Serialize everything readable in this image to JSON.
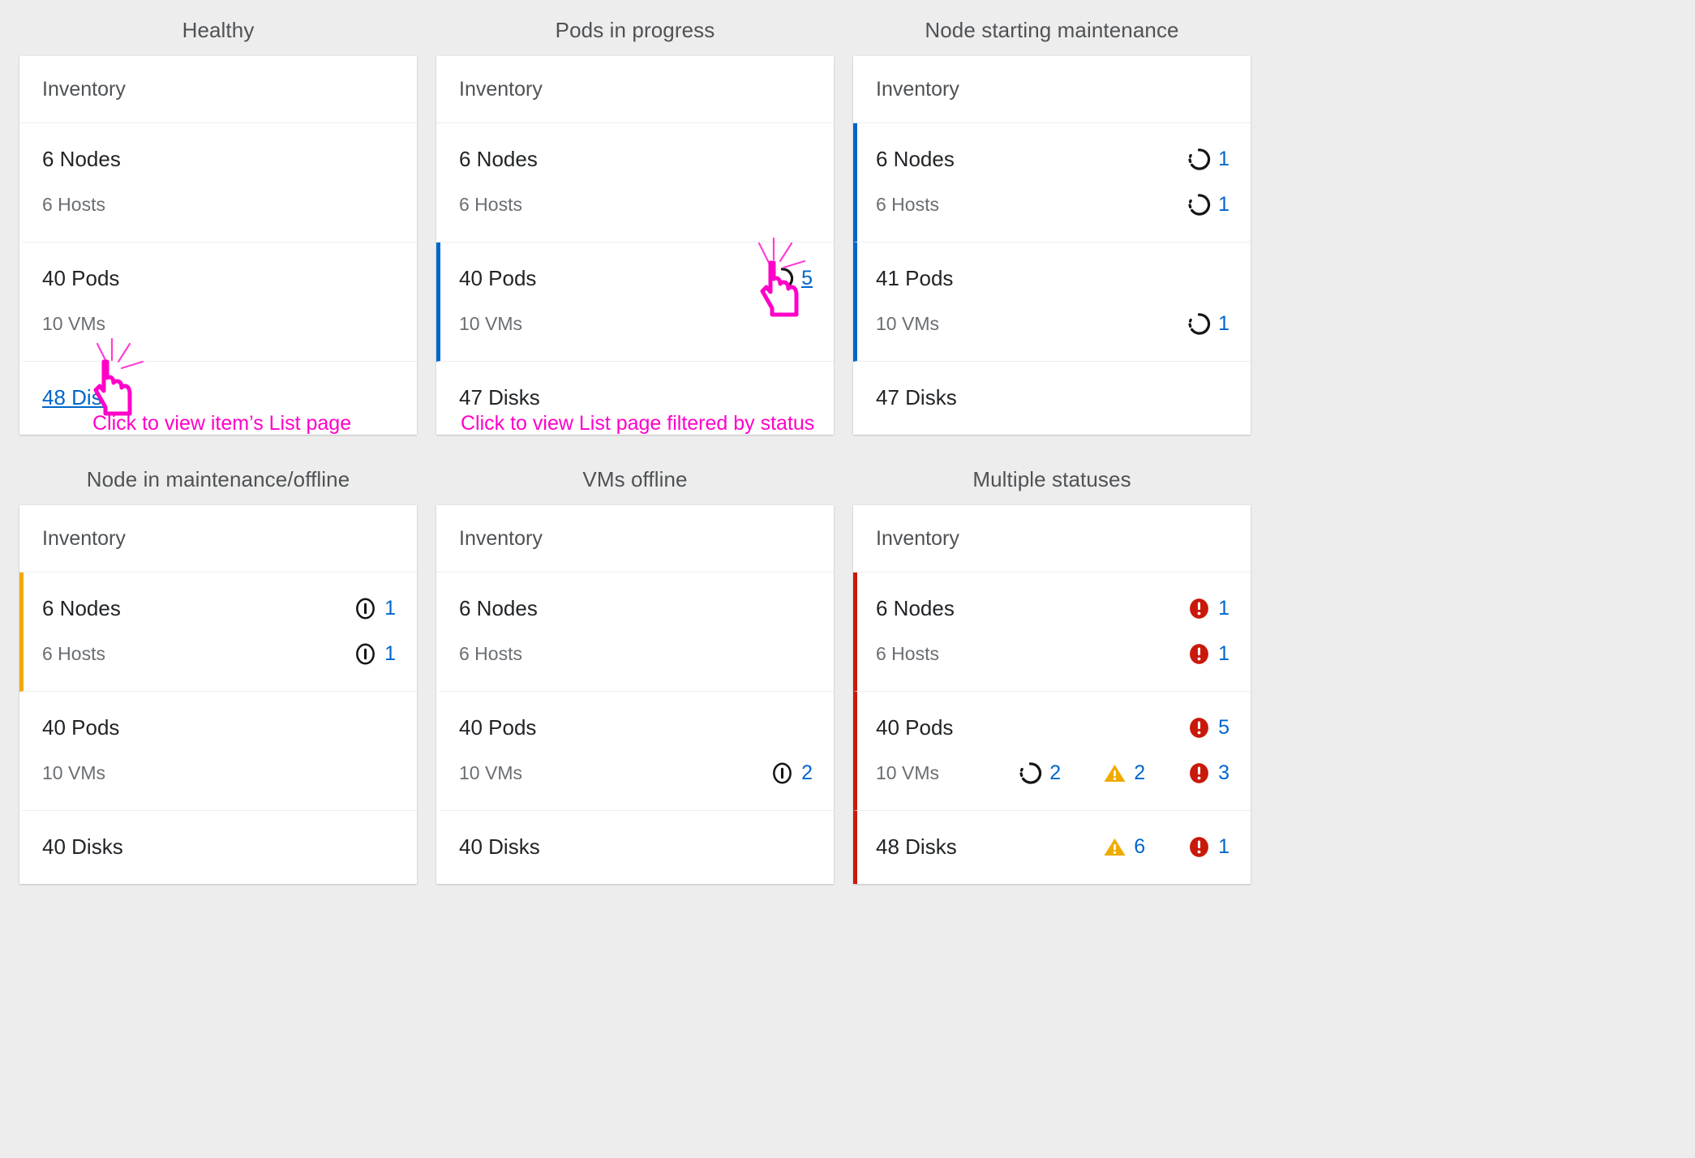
{
  "colors": {
    "background": "#ededed",
    "card_bg": "#ffffff",
    "text_primary": "#212427",
    "text_secondary": "#6a6e73",
    "title": "#4f5255",
    "link": "#0066cc",
    "accent_blue": "#06c",
    "accent_orange": "#f0ab00",
    "accent_red": "#c9190b",
    "warning": "#f0ab00",
    "danger": "#c9190b",
    "annotation": "#ff00c8"
  },
  "annotations": [
    {
      "id": "annot-list-page",
      "text": "Click to view item’s List page"
    },
    {
      "id": "annot-filtered",
      "text": "Click to view List page filtered by status"
    }
  ],
  "cards": [
    {
      "id": "healthy",
      "title": "Healthy",
      "header": "Inventory",
      "groups": [
        {
          "accent": "none",
          "rows": [
            {
              "label": "6 Nodes",
              "secondary": false,
              "link": false,
              "statuses": []
            },
            {
              "label": "6 Hosts",
              "secondary": true,
              "link": false,
              "statuses": []
            }
          ]
        },
        {
          "accent": "none",
          "rows": [
            {
              "label": "40 Pods",
              "secondary": false,
              "link": false,
              "statuses": []
            },
            {
              "label": "10 VMs",
              "secondary": true,
              "link": false,
              "statuses": []
            }
          ]
        },
        {
          "accent": "none",
          "rows": [
            {
              "label": "48 Disks",
              "secondary": false,
              "link": true,
              "statuses": []
            }
          ]
        }
      ]
    },
    {
      "id": "pods-in-progress",
      "title": "Pods in progress",
      "header": "Inventory",
      "groups": [
        {
          "accent": "none",
          "rows": [
            {
              "label": "6 Nodes",
              "secondary": false,
              "link": false,
              "statuses": []
            },
            {
              "label": "6 Hosts",
              "secondary": true,
              "link": false,
              "statuses": []
            }
          ]
        },
        {
          "accent": "blue",
          "rows": [
            {
              "label": "40 Pods",
              "secondary": false,
              "link": false,
              "statuses": [
                {
                  "icon": "in-progress-icon",
                  "count": "5",
                  "link": true
                }
              ]
            },
            {
              "label": "10 VMs",
              "secondary": true,
              "link": false,
              "statuses": []
            }
          ]
        },
        {
          "accent": "none",
          "rows": [
            {
              "label": "47 Disks",
              "secondary": false,
              "link": false,
              "statuses": []
            }
          ]
        }
      ]
    },
    {
      "id": "node-starting-maintenance",
      "title": "Node starting maintenance",
      "header": "Inventory",
      "groups": [
        {
          "accent": "blue",
          "rows": [
            {
              "label": "6 Nodes",
              "secondary": false,
              "link": false,
              "statuses": [
                {
                  "icon": "in-progress-icon",
                  "count": "1",
                  "link": false
                }
              ]
            },
            {
              "label": "6 Hosts",
              "secondary": true,
              "link": false,
              "statuses": [
                {
                  "icon": "in-progress-icon",
                  "count": "1",
                  "link": false
                }
              ]
            }
          ]
        },
        {
          "accent": "blue",
          "rows": [
            {
              "label": "41 Pods",
              "secondary": false,
              "link": false,
              "statuses": []
            },
            {
              "label": "10 VMs",
              "secondary": true,
              "link": false,
              "statuses": [
                {
                  "icon": "in-progress-icon",
                  "count": "1",
                  "link": false
                }
              ]
            }
          ]
        },
        {
          "accent": "none",
          "rows": [
            {
              "label": "47 Disks",
              "secondary": false,
              "link": false,
              "statuses": []
            }
          ]
        }
      ]
    },
    {
      "id": "node-in-maintenance-offline",
      "title": "Node in maintenance/offline",
      "header": "Inventory",
      "groups": [
        {
          "accent": "orange",
          "rows": [
            {
              "label": "6 Nodes",
              "secondary": false,
              "link": false,
              "statuses": [
                {
                  "icon": "offline-icon",
                  "count": "1",
                  "link": false
                }
              ]
            },
            {
              "label": "6 Hosts",
              "secondary": true,
              "link": false,
              "statuses": [
                {
                  "icon": "offline-icon",
                  "count": "1",
                  "link": false
                }
              ]
            }
          ]
        },
        {
          "accent": "none",
          "rows": [
            {
              "label": "40 Pods",
              "secondary": false,
              "link": false,
              "statuses": []
            },
            {
              "label": "10 VMs",
              "secondary": true,
              "link": false,
              "statuses": []
            }
          ]
        },
        {
          "accent": "none",
          "rows": [
            {
              "label": "40 Disks",
              "secondary": false,
              "link": false,
              "statuses": []
            }
          ]
        }
      ]
    },
    {
      "id": "vms-offline",
      "title": "VMs offline",
      "header": "Inventory",
      "groups": [
        {
          "accent": "none",
          "rows": [
            {
              "label": "6 Nodes",
              "secondary": false,
              "link": false,
              "statuses": []
            },
            {
              "label": "6 Hosts",
              "secondary": true,
              "link": false,
              "statuses": []
            }
          ]
        },
        {
          "accent": "none",
          "rows": [
            {
              "label": "40 Pods",
              "secondary": false,
              "link": false,
              "statuses": []
            },
            {
              "label": "10 VMs",
              "secondary": true,
              "link": false,
              "statuses": [
                {
                  "icon": "offline-icon",
                  "count": "2",
                  "link": false
                }
              ]
            }
          ]
        },
        {
          "accent": "none",
          "rows": [
            {
              "label": "40 Disks",
              "secondary": false,
              "link": false,
              "statuses": []
            }
          ]
        }
      ]
    },
    {
      "id": "multiple-statuses",
      "title": "Multiple statuses",
      "header": "Inventory",
      "groups": [
        {
          "accent": "red",
          "rows": [
            {
              "label": "6 Nodes",
              "secondary": false,
              "link": false,
              "statuses": [
                {
                  "icon": "error-icon",
                  "count": "1",
                  "link": false
                }
              ]
            },
            {
              "label": "6 Hosts",
              "secondary": true,
              "link": false,
              "statuses": [
                {
                  "icon": "error-icon",
                  "count": "1",
                  "link": false
                }
              ]
            }
          ]
        },
        {
          "accent": "red",
          "rows": [
            {
              "label": "40 Pods",
              "secondary": false,
              "link": false,
              "statuses": [
                {
                  "icon": "error-icon",
                  "count": "5",
                  "link": false
                }
              ]
            },
            {
              "label": "10 VMs",
              "secondary": true,
              "link": false,
              "statuses": [
                {
                  "icon": "in-progress-icon",
                  "count": "2",
                  "link": false
                },
                {
                  "icon": "warning-icon",
                  "count": "2",
                  "link": false
                },
                {
                  "icon": "error-icon",
                  "count": "3",
                  "link": false
                }
              ]
            }
          ]
        },
        {
          "accent": "red",
          "rows": [
            {
              "label": "48 Disks",
              "secondary": false,
              "link": false,
              "statuses": [
                {
                  "icon": "warning-icon",
                  "count": "6",
                  "link": false
                },
                {
                  "icon": "error-icon",
                  "count": "1",
                  "link": false
                }
              ]
            }
          ]
        }
      ]
    }
  ]
}
